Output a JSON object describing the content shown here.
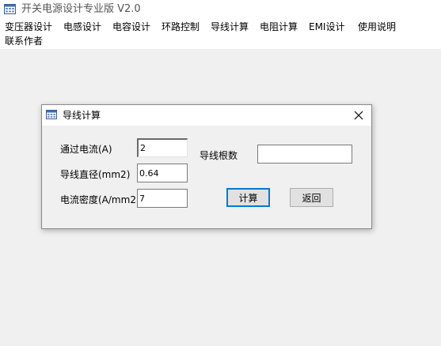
{
  "app": {
    "title": "开关电源设计专业版  V2.0"
  },
  "menu": {
    "items": [
      "变压器设计",
      "电感设计",
      "电容设计",
      "环路控制",
      "导线计算",
      "电阻计算",
      "EMI设计",
      "使用说明",
      "联系作者"
    ]
  },
  "dialog": {
    "title": "导线计算",
    "fields": {
      "current_label": "通过电流(A)",
      "current_value": "2",
      "diameter_label": "导线直径(mm2)",
      "diameter_value": "0.64",
      "density_label": "电流密度(A/mm2)",
      "density_value": "7",
      "count_label": "导线根数",
      "count_value": ""
    },
    "buttons": {
      "calculate": "计算",
      "back": "返回"
    }
  },
  "icons": {
    "app_icon": "window-app-icon",
    "dialog_icon": "window-app-icon",
    "close_icon": "close-icon"
  },
  "colors": {
    "title_bar": "#ffffff",
    "background": "#f0f0f0",
    "default_button_border": "#0078d7"
  }
}
